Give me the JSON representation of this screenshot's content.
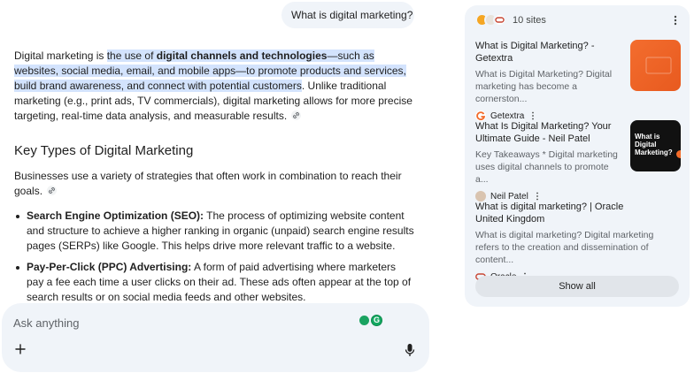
{
  "query": "What is digital marketing?",
  "answer": {
    "p1_lead": "Digital marketing is ",
    "p1_hl_a": "the use of ",
    "p1_hl_bold": "digital channels and technologies",
    "p1_hl_b": "—such as websites, social media, email, and mobile apps—to promote products and services, build brand awareness, and connect with potential customers",
    "p1_tail": ". Unlike traditional marketing (e.g., print ads, TV commercials), digital marketing allows for more precise targeting, real-time data analysis, and measurable results.",
    "heading": "Key Types of Digital Marketing",
    "p2": "Businesses use a variety of strategies that often work in combination to reach their goals.",
    "bullets": [
      {
        "term": "Search Engine Optimization (SEO):",
        "text": " The process of optimizing website content and structure to achieve a higher ranking in organic (unpaid) search engine results pages (SERPs) like Google. This helps drive more relevant traffic to a website."
      },
      {
        "term": "Pay-Per-Click (PPC) Advertising:",
        "text": " A form of paid advertising where marketers pay a fee each time a user clicks on their ad. These ads often appear at the top of search results or on social media feeds and other websites."
      }
    ]
  },
  "composer": {
    "placeholder": "Ask anything",
    "ext_badge": "G"
  },
  "sources": {
    "count_label": "10 sites",
    "items": [
      {
        "title": "What is Digital Marketing? - Getextra",
        "snippet": "What is Digital Marketing? Digital marketing has become a cornerston...",
        "site": "Getextra"
      },
      {
        "title": "What Is Digital Marketing? Your Ultimate Guide - Neil Patel",
        "snippet": "Key Takeaways * Digital marketing uses digital channels to promote a...",
        "site": "Neil Patel",
        "thumb_text": "What is Digital Marketing?"
      },
      {
        "title": "What is digital marketing? | Oracle United Kingdom",
        "snippet": "What is digital marketing? Digital marketing refers to the creation and dissemination of content...",
        "site": "Oracle"
      }
    ],
    "show_all_label": "Show all"
  },
  "colors": {
    "highlight": "#d3e3fd",
    "panel_bg": "#f0f4f9",
    "getextra_orange": "#f26b2b",
    "neilpatel_orange": "#f36c2a",
    "oracle_red": "#c74634"
  },
  "icons": [
    "link-icon",
    "plus-icon",
    "mic-icon",
    "more-vert-icon",
    "grammarly-icon"
  ]
}
